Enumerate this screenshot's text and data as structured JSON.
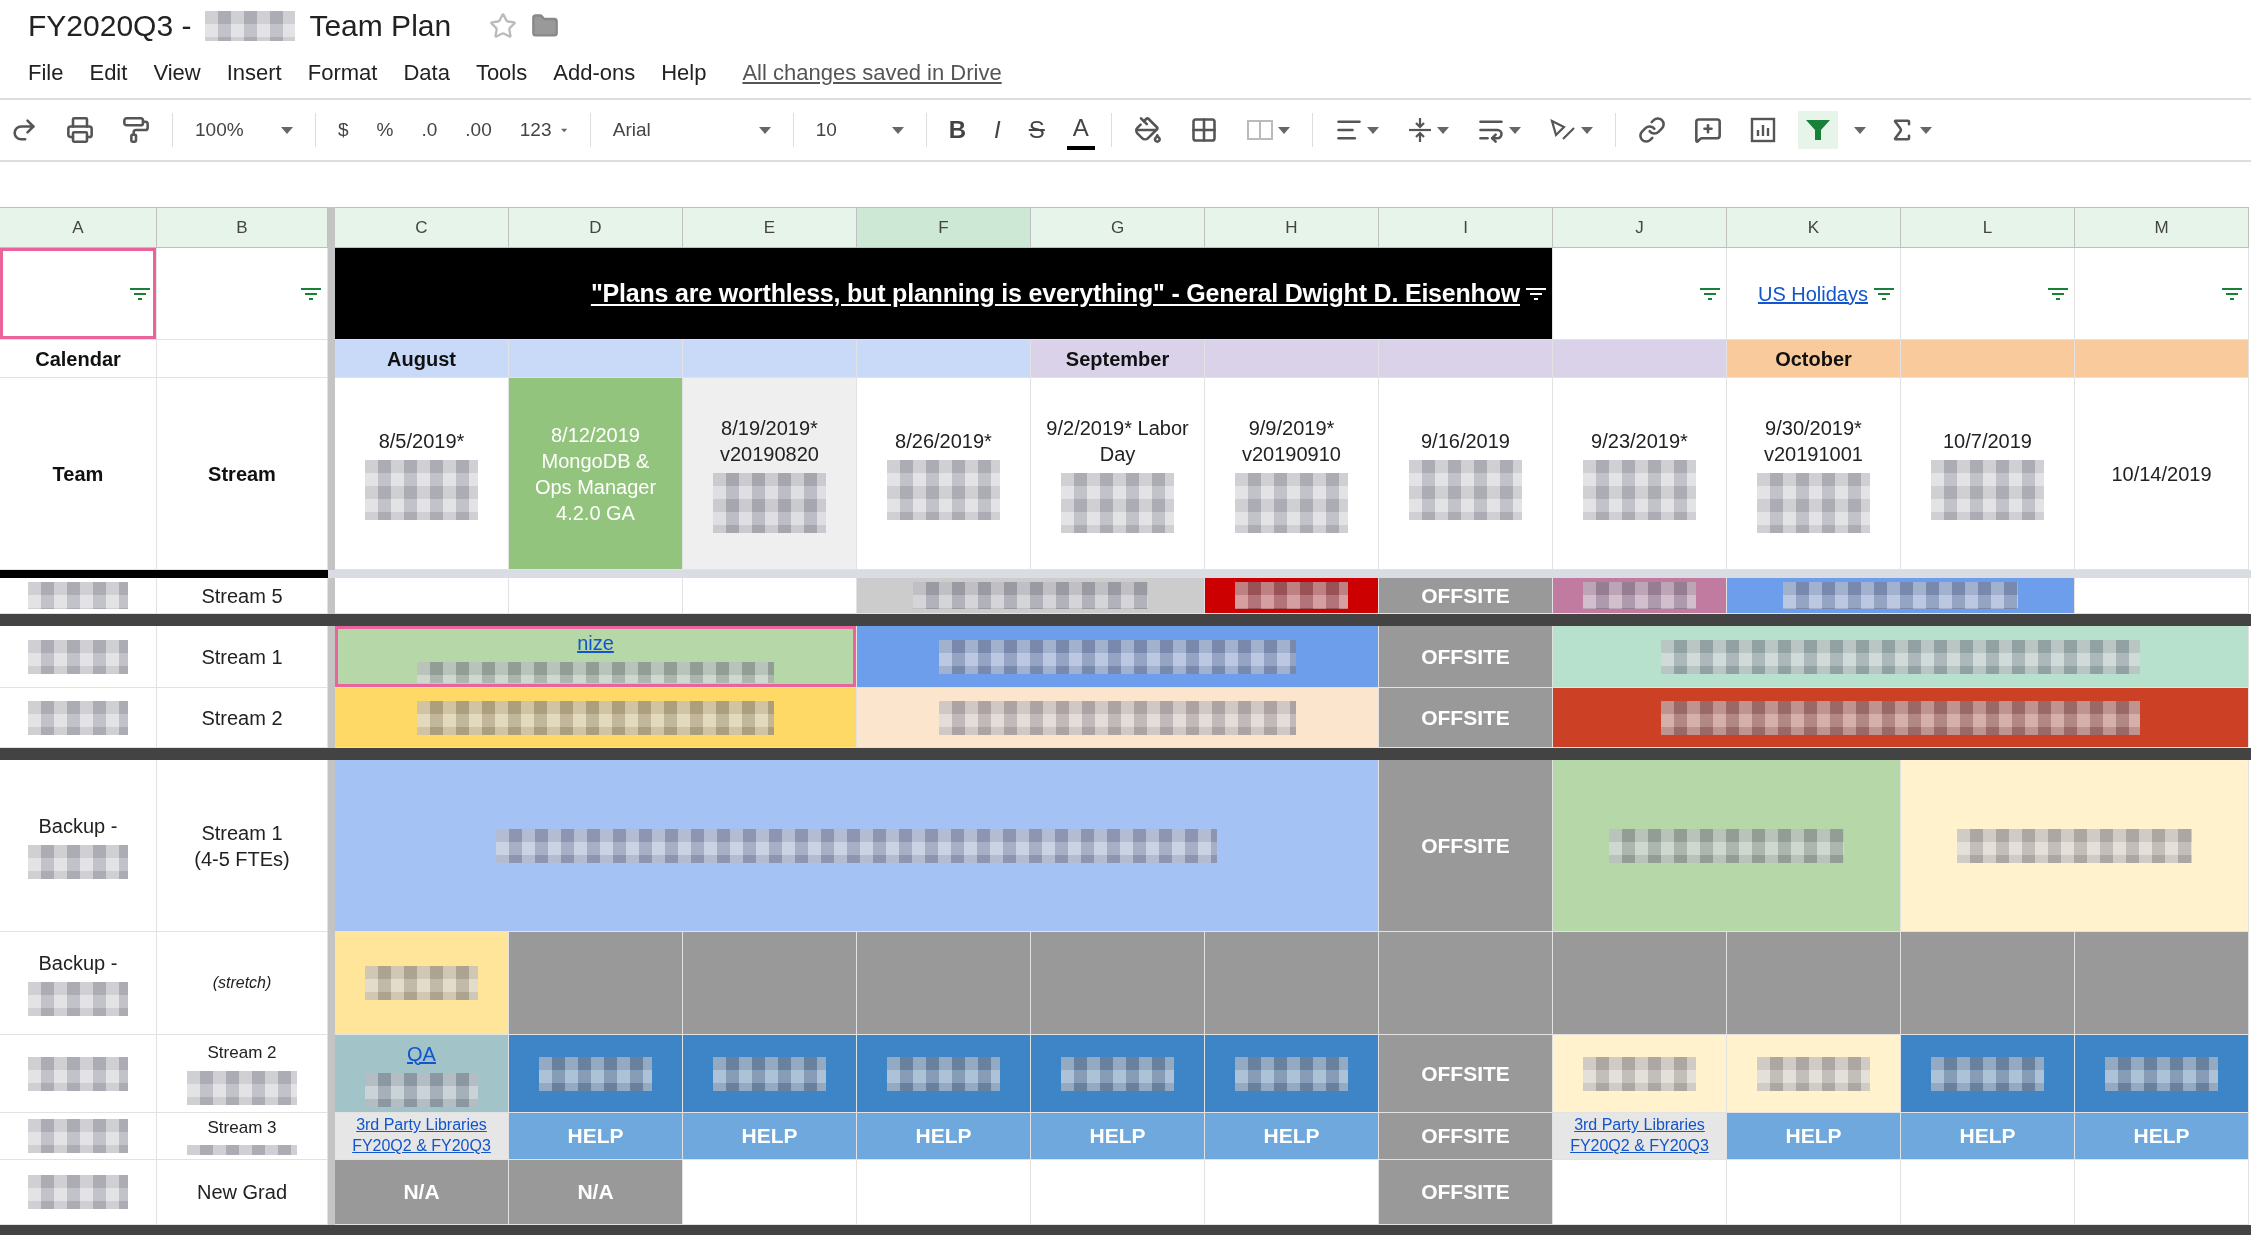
{
  "title": {
    "before": "FY2020Q3 -",
    "after": "Team Plan",
    "starred": false
  },
  "menu": [
    "File",
    "Edit",
    "View",
    "Insert",
    "Format",
    "Data",
    "Tools",
    "Add-ons",
    "Help"
  ],
  "save_status": "All changes saved in Drive",
  "toolbar": {
    "zoom": "100%",
    "number_formats": [
      "$",
      "%",
      ".0",
      ".00"
    ],
    "more_formats": "123",
    "font": "Arial",
    "font_size": "10",
    "styles": [
      "B",
      "I",
      "S",
      "A"
    ],
    "filter_on": true
  },
  "columns": [
    {
      "letter": "A",
      "selected": false
    },
    {
      "letter": "B",
      "selected": false
    },
    {
      "letter": "C",
      "selected": false
    },
    {
      "letter": "D",
      "selected": false
    },
    {
      "letter": "E",
      "selected": false
    },
    {
      "letter": "F",
      "selected": true
    },
    {
      "letter": "G",
      "selected": false
    },
    {
      "letter": "H",
      "selected": false
    },
    {
      "letter": "I",
      "selected": false
    },
    {
      "letter": "J",
      "selected": false
    },
    {
      "letter": "K",
      "selected": false
    },
    {
      "letter": "L",
      "selected": false
    },
    {
      "letter": "M",
      "selected": false
    }
  ],
  "rows": [
    {
      "kind": "quote",
      "cells": [
        {
          "kind": "empty",
          "filter": true,
          "selected": true
        },
        {
          "kind": "empty",
          "filter": true,
          "selected": false
        },
        {
          "kind": "quote",
          "text": "\"Plans are worthless, but planning is everything\" - General Dwight D. Eisenhow",
          "color": "#000000",
          "filter": true,
          "selected": false
        },
        {
          "kind": "continued"
        },
        {
          "kind": "continued"
        },
        {
          "kind": "continued"
        },
        {
          "kind": "continued"
        },
        {
          "kind": "continued"
        },
        {
          "kind": "continued"
        },
        {
          "kind": "empty",
          "filter": true,
          "selected": false
        },
        {
          "kind": "link",
          "text": "US Holidays",
          "filter": true,
          "selected": false
        },
        {
          "kind": "empty",
          "filter": true,
          "selected": false
        },
        {
          "kind": "empty",
          "filter": true,
          "selected": false
        }
      ]
    },
    {
      "kind": "months",
      "cells": [
        {
          "kind": "bold",
          "text": "Calendar",
          "selected": false
        },
        {
          "kind": "empty",
          "selected": false
        },
        {
          "kind": "bold",
          "text": "August",
          "color": "#c9daf8",
          "selected": false
        },
        {
          "kind": "empty",
          "color": "#c9daf8",
          "selected": false
        },
        {
          "kind": "empty",
          "color": "#c9daf8",
          "selected": false
        },
        {
          "kind": "empty",
          "color": "#c9daf8",
          "selected": false
        },
        {
          "kind": "bold",
          "text": "September",
          "color": "#d9d2e9",
          "selected": false
        },
        {
          "kind": "empty",
          "color": "#d9d2e9",
          "selected": false
        },
        {
          "kind": "empty",
          "color": "#d9d2e9",
          "selected": false
        },
        {
          "kind": "empty",
          "color": "#d9d2e9",
          "selected": false
        },
        {
          "kind": "bold",
          "text": "October",
          "color": "#f9cb9c",
          "selected": false
        },
        {
          "kind": "empty",
          "color": "#f9cb9c",
          "selected": false
        },
        {
          "kind": "empty",
          "color": "#f9cb9c",
          "selected": false
        }
      ]
    },
    {
      "kind": "dates",
      "cells": [
        {
          "kind": "bold",
          "text": "Team",
          "selected": false
        },
        {
          "kind": "bold",
          "text": "Stream",
          "selected": false
        },
        {
          "kind": "text",
          "text": "8/5/2019*",
          "redacted": true,
          "selected": false
        },
        {
          "kind": "white",
          "text": "8/12/2019\nMongoDB &\nOps Manager\n4.2.0 GA",
          "color": "#93c47d",
          "selected": false
        },
        {
          "kind": "text",
          "text": "8/19/2019*\nv20190820",
          "redacted": true,
          "color": "#efefef",
          "selected": false
        },
        {
          "kind": "text",
          "text": "8/26/2019*",
          "redacted": true,
          "selected": false
        },
        {
          "kind": "text",
          "text": "9/2/2019* Labor\nDay",
          "redacted": true,
          "selected": false
        },
        {
          "kind": "text",
          "text": "9/9/2019*\nv20190910",
          "redacted": true,
          "selected": false
        },
        {
          "kind": "text",
          "text": "9/16/2019",
          "redacted": true,
          "selected": false
        },
        {
          "kind": "text",
          "text": "9/23/2019*",
          "redacted": true,
          "selected": false
        },
        {
          "kind": "text",
          "text": "9/30/2019*\nv20191001",
          "redacted": true,
          "selected": false
        },
        {
          "kind": "text",
          "text": "10/7/2019",
          "redacted": true,
          "selected": false
        },
        {
          "kind": "text",
          "text": "10/14/2019",
          "selected": false
        }
      ]
    },
    {
      "kind": "rule"
    },
    {
      "kind": "data",
      "cells": [
        {
          "kind": "empty",
          "redacted": true,
          "selected": false
        },
        {
          "kind": "text",
          "text": "Stream 5",
          "selected": false
        },
        {
          "kind": "empty",
          "selected": false
        },
        {
          "kind": "empty",
          "selected": false
        },
        {
          "kind": "empty",
          "selected": false
        },
        {
          "kind": "empty",
          "redacted": true,
          "color": "#cccccc",
          "selected": false
        },
        {
          "kind": "continued"
        },
        {
          "kind": "empty",
          "redacted": true,
          "color": "#cc0000",
          "selected": false
        },
        {
          "kind": "label",
          "text": "OFFSITE",
          "color": "#999999",
          "selected": false
        },
        {
          "kind": "empty",
          "redacted": true,
          "color": "#c27ba0",
          "selected": false
        },
        {
          "kind": "empty",
          "redacted": true,
          "color": "#6d9eeb",
          "selected": false
        },
        {
          "kind": "continued"
        },
        {
          "kind": "empty",
          "selected": false
        }
      ]
    },
    {
      "kind": "divider"
    },
    {
      "kind": "data",
      "cells": [
        {
          "kind": "empty",
          "redacted": true,
          "selected": false
        },
        {
          "kind": "text",
          "text": "Stream 1",
          "selected": false
        },
        {
          "kind": "link",
          "text": "nize",
          "redacted": true,
          "color": "#b6d7a8",
          "selected": true
        },
        {
          "kind": "continued"
        },
        {
          "kind": "continued"
        },
        {
          "kind": "empty",
          "redacted": true,
          "color": "#6d9eeb",
          "selected": false
        },
        {
          "kind": "continued"
        },
        {
          "kind": "continued"
        },
        {
          "kind": "label",
          "text": "OFFSITE",
          "color": "#999999",
          "selected": false
        },
        {
          "kind": "empty",
          "redacted": true,
          "color": "#b7e1cd",
          "selected": false
        },
        {
          "kind": "continued"
        },
        {
          "kind": "continued"
        },
        {
          "kind": "continued"
        }
      ]
    },
    {
      "kind": "data",
      "cells": [
        {
          "kind": "empty",
          "redacted": true,
          "selected": false
        },
        {
          "kind": "text",
          "text": "Stream 2",
          "selected": false
        },
        {
          "kind": "empty",
          "redacted": true,
          "color": "#ffd966",
          "selected": false
        },
        {
          "kind": "continued"
        },
        {
          "kind": "continued"
        },
        {
          "kind": "empty",
          "redacted": true,
          "color": "#fce5cd",
          "selected": false
        },
        {
          "kind": "continued"
        },
        {
          "kind": "continued"
        },
        {
          "kind": "label",
          "text": "OFFSITE",
          "color": "#999999",
          "selected": false
        },
        {
          "kind": "empty",
          "redacted": true,
          "color": "#cc4125",
          "selected": false
        },
        {
          "kind": "continued"
        },
        {
          "kind": "continued"
        },
        {
          "kind": "continued"
        }
      ]
    },
    {
      "kind": "divider"
    },
    {
      "kind": "data",
      "cells": [
        {
          "kind": "text",
          "text": "Backup -",
          "redacted": true,
          "selected": false
        },
        {
          "kind": "text",
          "text": "Stream 1\n(4-5 FTEs)",
          "selected": false
        },
        {
          "kind": "empty",
          "redacted": true,
          "color": "#a4c2f4",
          "selected": false
        },
        {
          "kind": "continued"
        },
        {
          "kind": "continued"
        },
        {
          "kind": "continued"
        },
        {
          "kind": "continued"
        },
        {
          "kind": "continued"
        },
        {
          "kind": "label",
          "text": "OFFSITE",
          "color": "#999999",
          "selected": false
        },
        {
          "kind": "empty",
          "redacted": true,
          "color": "#b6d7a8",
          "selected": false
        },
        {
          "kind": "continued"
        },
        {
          "kind": "empty",
          "redacted": true,
          "color": "#fff2cc",
          "selected": false
        },
        {
          "kind": "continued"
        }
      ]
    },
    {
      "kind": "data",
      "cells": [
        {
          "kind": "text",
          "text": "Backup -",
          "redacted": true,
          "selected": false
        },
        {
          "kind": "italic",
          "text": "(stretch)",
          "selected": false
        },
        {
          "kind": "empty",
          "redacted": true,
          "color": "#ffe599",
          "selected": false
        },
        {
          "kind": "empty",
          "color": "#999999",
          "selected": false
        },
        {
          "kind": "empty",
          "color": "#999999",
          "selected": false
        },
        {
          "kind": "empty",
          "color": "#999999",
          "selected": false
        },
        {
          "kind": "empty",
          "color": "#999999",
          "selected": false
        },
        {
          "kind": "empty",
          "color": "#999999",
          "selected": false
        },
        {
          "kind": "empty",
          "color": "#999999",
          "selected": false
        },
        {
          "kind": "empty",
          "color": "#999999",
          "selected": false
        },
        {
          "kind": "empty",
          "color": "#999999",
          "selected": false
        },
        {
          "kind": "empty",
          "color": "#999999",
          "selected": false
        },
        {
          "kind": "empty",
          "color": "#999999",
          "selected": false
        }
      ]
    },
    {
      "kind": "data",
      "cells": [
        {
          "kind": "empty",
          "redacted": true,
          "selected": false
        },
        {
          "kind": "small",
          "text": "Stream 2",
          "redacted": true,
          "selected": false
        },
        {
          "kind": "link",
          "text": "QA",
          "redacted": true,
          "color": "#a2c4c9",
          "selected": false
        },
        {
          "kind": "empty",
          "redacted": true,
          "color": "#3d85c6",
          "selected": false
        },
        {
          "kind": "empty",
          "redacted": true,
          "color": "#3d85c6",
          "selected": false
        },
        {
          "kind": "empty",
          "redacted": true,
          "color": "#3d85c6",
          "selected": false
        },
        {
          "kind": "empty",
          "redacted": true,
          "color": "#3d85c6",
          "selected": false
        },
        {
          "kind": "empty",
          "redacted": true,
          "color": "#3d85c6",
          "selected": false
        },
        {
          "kind": "label",
          "text": "OFFSITE",
          "color": "#999999",
          "selected": false
        },
        {
          "kind": "empty",
          "redacted": true,
          "color": "#fff2cc",
          "selected": false
        },
        {
          "kind": "empty",
          "redacted": true,
          "color": "#fff2cc",
          "selected": false
        },
        {
          "kind": "empty",
          "redacted": true,
          "color": "#3d85c6",
          "selected": false
        },
        {
          "kind": "empty",
          "redacted": true,
          "color": "#3d85c6",
          "selected": false
        }
      ]
    },
    {
      "kind": "data",
      "cells": [
        {
          "kind": "empty",
          "redacted": true,
          "selected": false
        },
        {
          "kind": "small",
          "text": "Stream 3",
          "redacted": true,
          "selected": false
        },
        {
          "kind": "link",
          "text": "3rd Party Libraries\nFY20Q2 & FY20Q3",
          "color": "#e6e6e6",
          "selected": false
        },
        {
          "kind": "label",
          "text": "HELP",
          "color": "#6fa8dc",
          "selected": false
        },
        {
          "kind": "label",
          "text": "HELP",
          "color": "#6fa8dc",
          "selected": false
        },
        {
          "kind": "label",
          "text": "HELP",
          "color": "#6fa8dc",
          "selected": false
        },
        {
          "kind": "label",
          "text": "HELP",
          "color": "#6fa8dc",
          "selected": false
        },
        {
          "kind": "label",
          "text": "HELP",
          "color": "#6fa8dc",
          "selected": false
        },
        {
          "kind": "label",
          "text": "OFFSITE",
          "color": "#999999",
          "selected": false
        },
        {
          "kind": "link",
          "text": "3rd Party Libraries\nFY20Q2 & FY20Q3",
          "color": "#e6e6e6",
          "selected": false
        },
        {
          "kind": "label",
          "text": "HELP",
          "color": "#6fa8dc",
          "selected": false
        },
        {
          "kind": "label",
          "text": "HELP",
          "color": "#6fa8dc",
          "selected": false
        },
        {
          "kind": "label",
          "text": "HELP",
          "color": "#6fa8dc",
          "selected": false
        }
      ]
    },
    {
      "kind": "data",
      "cells": [
        {
          "kind": "empty",
          "redacted": true,
          "selected": false
        },
        {
          "kind": "text",
          "text": "New Grad",
          "selected": false
        },
        {
          "kind": "label",
          "text": "N/A",
          "color": "#999999",
          "selected": false
        },
        {
          "kind": "label",
          "text": "N/A",
          "color": "#999999",
          "selected": false
        },
        {
          "kind": "empty",
          "selected": false
        },
        {
          "kind": "empty",
          "selected": false
        },
        {
          "kind": "empty",
          "selected": false
        },
        {
          "kind": "empty",
          "selected": false
        },
        {
          "kind": "label",
          "text": "OFFSITE",
          "color": "#999999",
          "selected": false
        },
        {
          "kind": "empty",
          "selected": false
        },
        {
          "kind": "empty",
          "selected": false
        },
        {
          "kind": "empty",
          "selected": false
        },
        {
          "kind": "empty",
          "selected": false
        }
      ]
    },
    {
      "kind": "divider"
    }
  ]
}
